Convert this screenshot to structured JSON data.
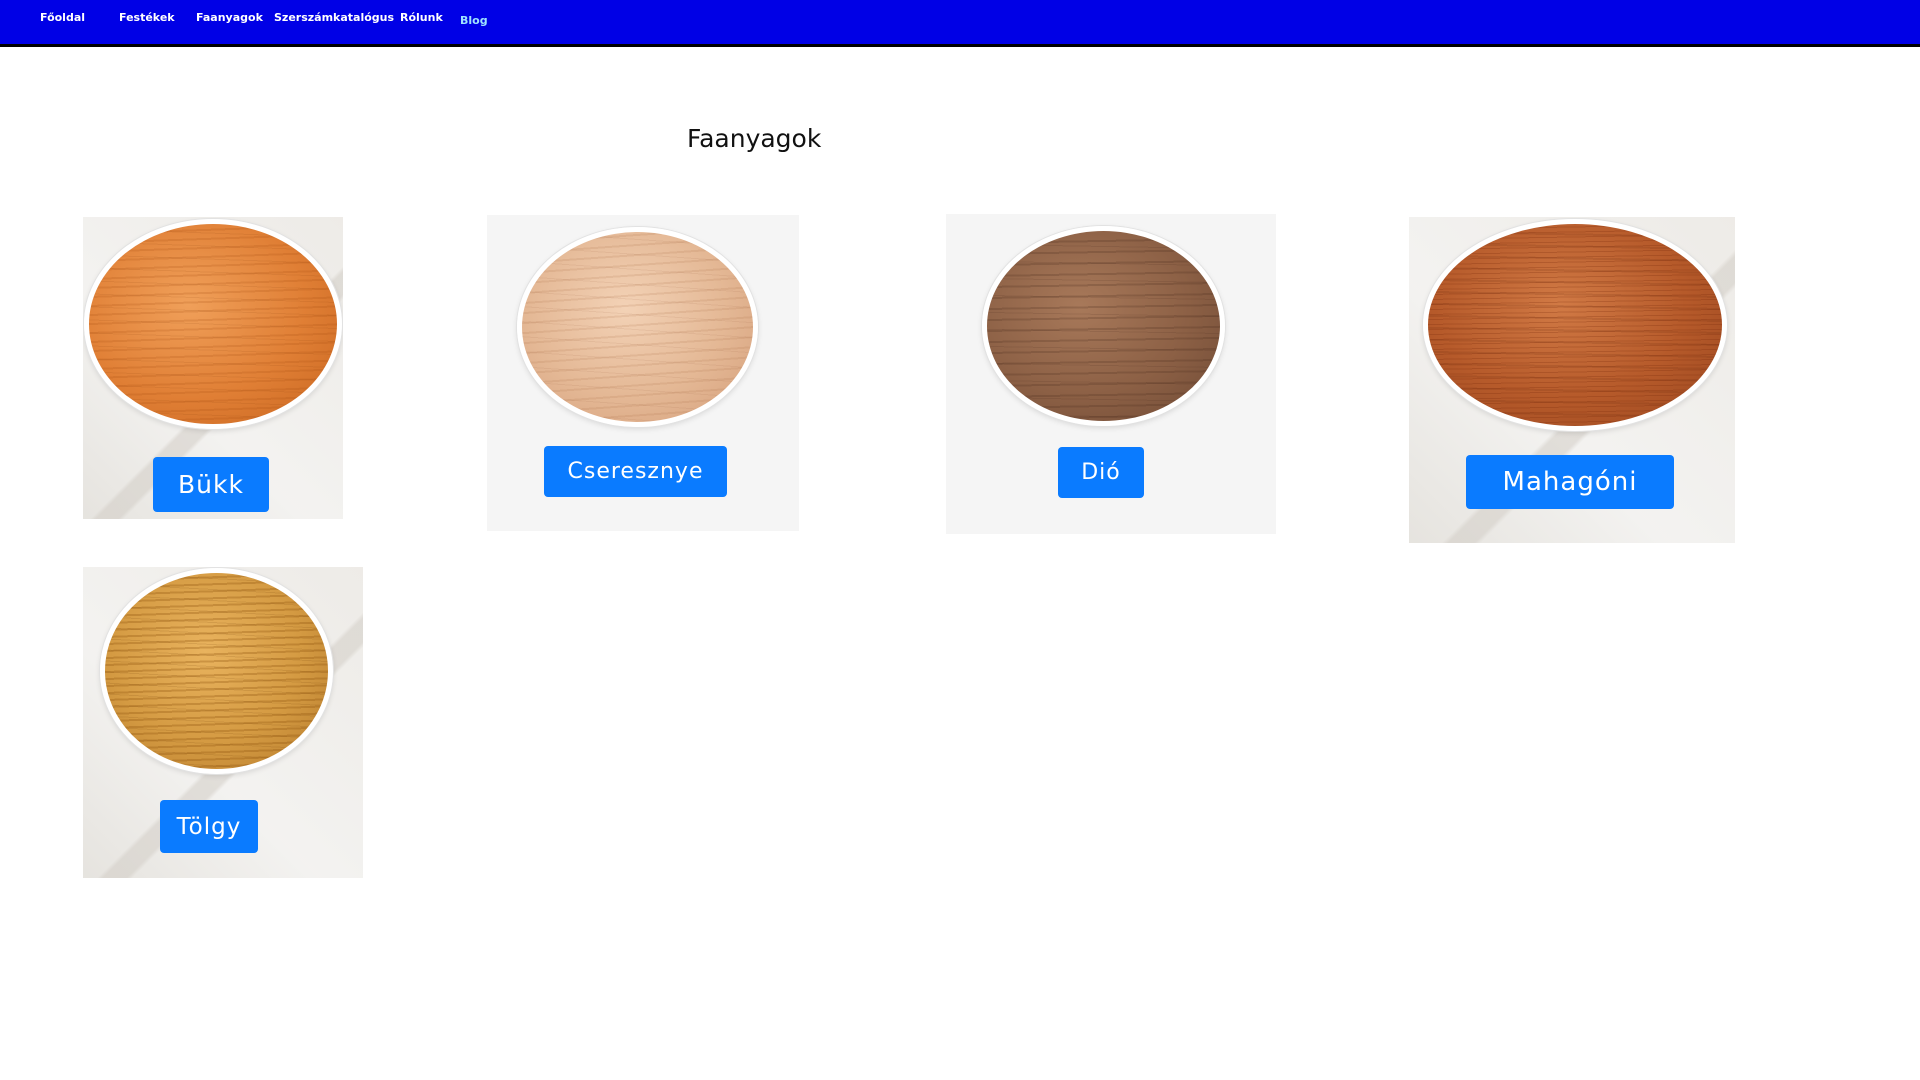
{
  "nav": {
    "items": [
      {
        "label": "Főoldal"
      },
      {
        "label": "Festékek"
      },
      {
        "label": "Faanyagok"
      },
      {
        "label": "Szerszámkatalógus"
      },
      {
        "label": "Rólunk"
      },
      {
        "label": "Blog"
      }
    ]
  },
  "page": {
    "title": "Faanyagok"
  },
  "woods": [
    {
      "label": "Bükk"
    },
    {
      "label": "Cseresznye"
    },
    {
      "label": "Dió"
    },
    {
      "label": "Mahagóni"
    },
    {
      "label": "Tölgy"
    }
  ],
  "colors": {
    "navbar": "#0000e6",
    "button": "#0a7bff"
  }
}
